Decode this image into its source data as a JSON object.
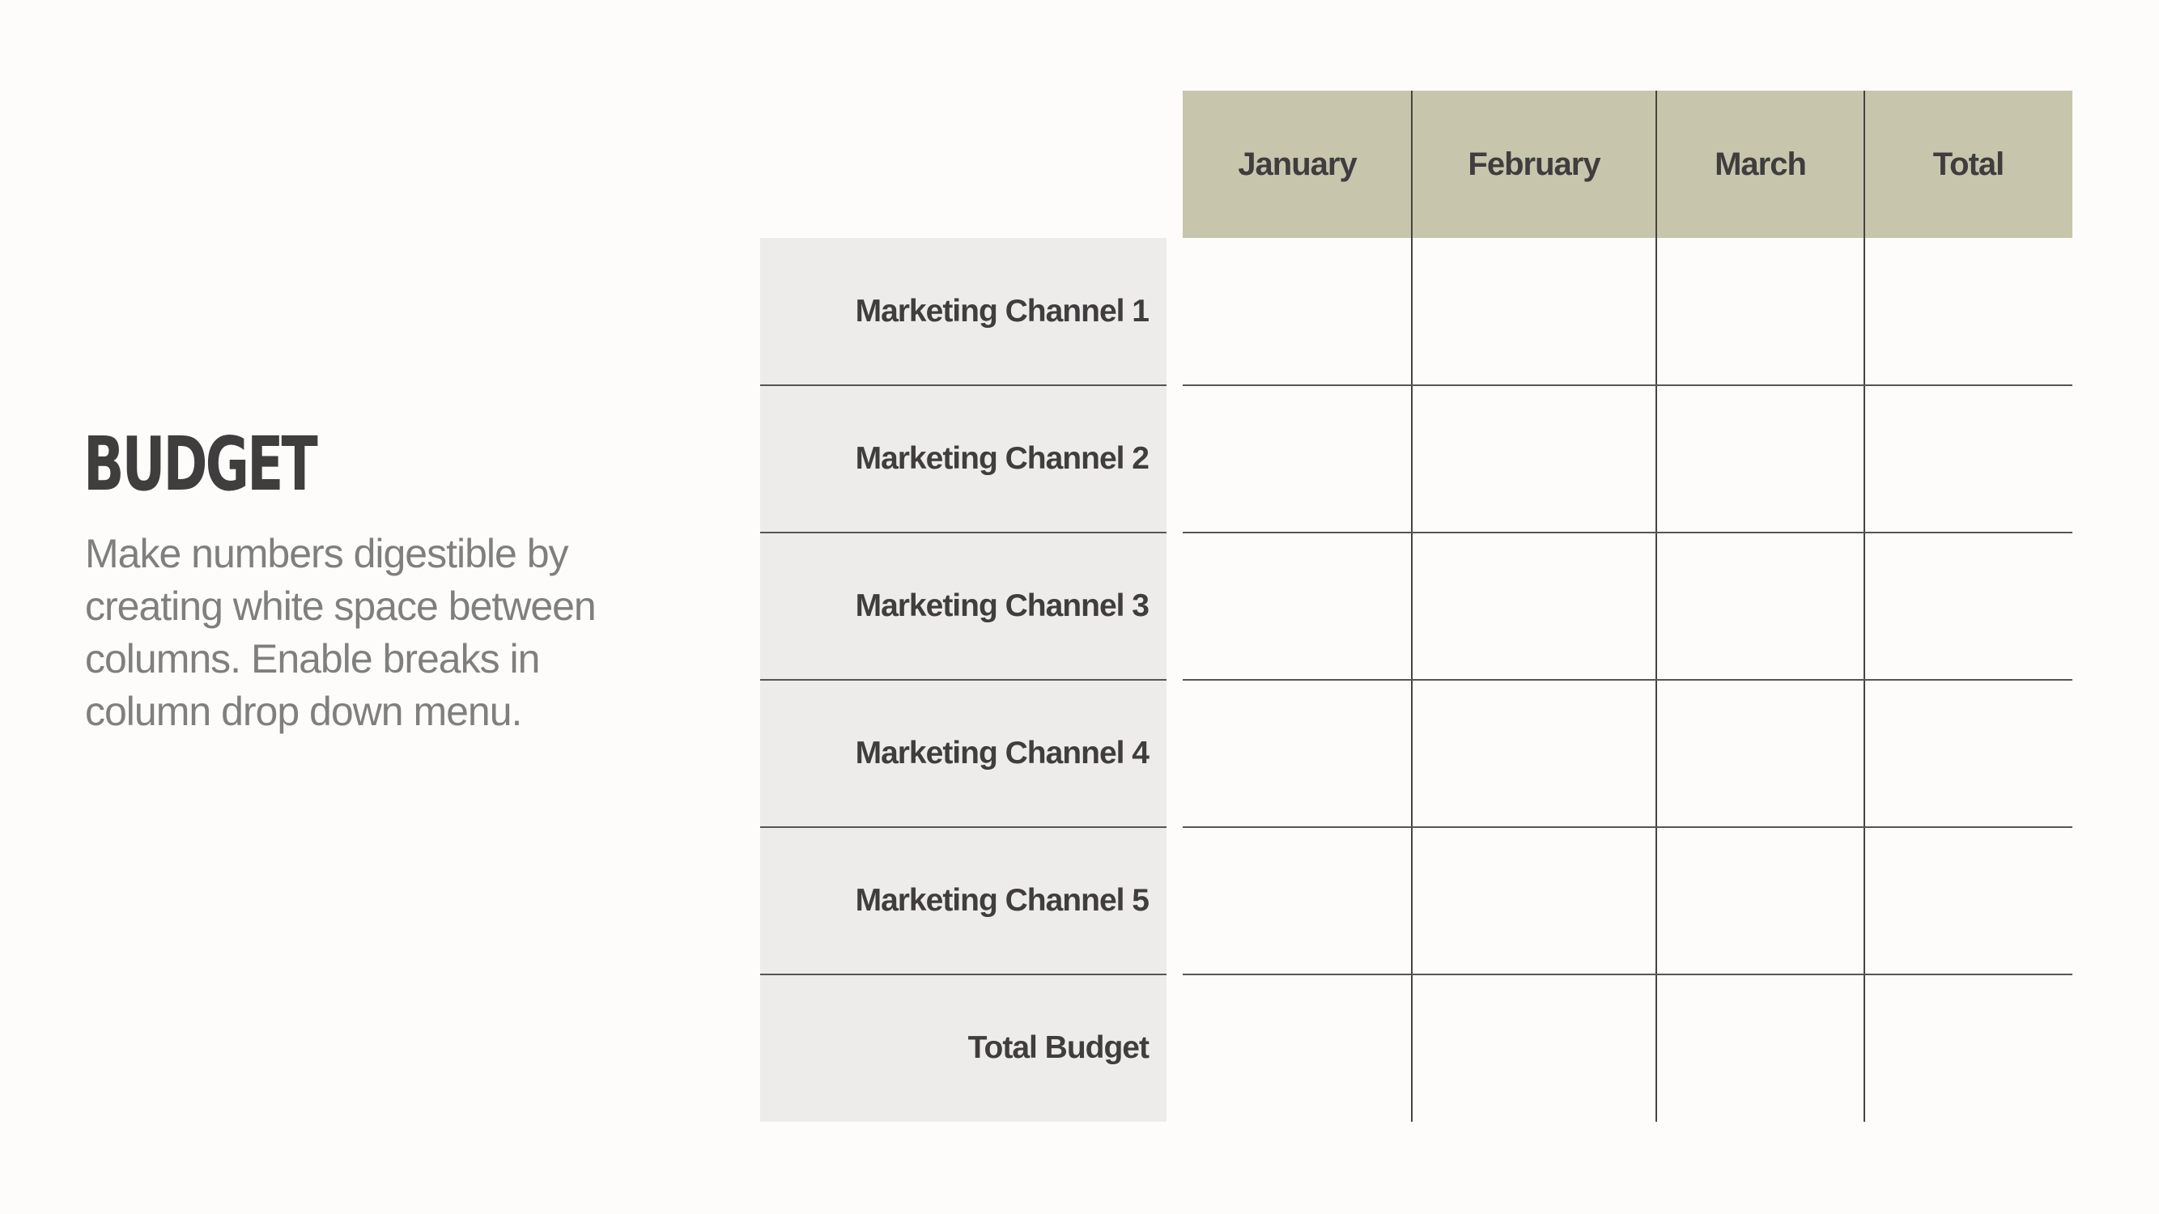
{
  "slide": {
    "title": "BUDGET",
    "description": "Make numbers digestible by creating white space between columns. Enable breaks in column drop down menu."
  },
  "table": {
    "columns": [
      "January",
      "February",
      "March",
      "Total"
    ],
    "rows": [
      {
        "label": "Marketing Channel 1",
        "values": [
          "",
          "",
          "",
          ""
        ]
      },
      {
        "label": "Marketing Channel 2",
        "values": [
          "",
          "",
          "",
          ""
        ]
      },
      {
        "label": "Marketing Channel 3",
        "values": [
          "",
          "",
          "",
          ""
        ]
      },
      {
        "label": "Marketing Channel 4",
        "values": [
          "",
          "",
          "",
          ""
        ]
      },
      {
        "label": "Marketing Channel 5",
        "values": [
          "",
          "",
          "",
          ""
        ]
      },
      {
        "label": "Total Budget",
        "values": [
          "",
          "",
          "",
          ""
        ]
      }
    ],
    "colors": {
      "header_bg": "#c7c6ad",
      "label_bg": "#eeecea",
      "text": "#403d3e",
      "body_text": "#7f7f80"
    }
  }
}
